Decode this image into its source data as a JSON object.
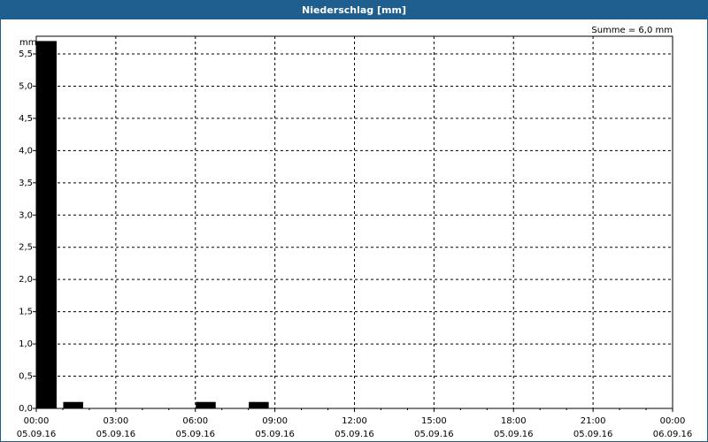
{
  "window": {
    "title": "Niederschlag [mm]"
  },
  "chart_data": {
    "type": "bar",
    "title": "Niederschlag [mm]",
    "ylabel": "mm",
    "xlabel": "",
    "summary": "Summe = 6,0 mm",
    "ylim": [
      0,
      5.5
    ],
    "yticks": [
      0.0,
      0.5,
      1.0,
      1.5,
      2.0,
      2.5,
      3.0,
      3.5,
      4.0,
      4.5,
      5.0,
      5.5
    ],
    "ytick_labels": [
      "0,0",
      "0,5",
      "1,0",
      "1,5",
      "2,0",
      "2,5",
      "3,0",
      "3,5",
      "4,0",
      "4,5",
      "5,0",
      "5,5"
    ],
    "x_range_hours": [
      0,
      24
    ],
    "xticks": [
      {
        "time": "00:00",
        "date": "05.09.16",
        "hour": 0
      },
      {
        "time": "03:00",
        "date": "05.09.16",
        "hour": 3
      },
      {
        "time": "06:00",
        "date": "05.09.16",
        "hour": 6
      },
      {
        "time": "09:00",
        "date": "05.09.16",
        "hour": 9
      },
      {
        "time": "12:00",
        "date": "05.09.16",
        "hour": 12
      },
      {
        "time": "15:00",
        "date": "05.09.16",
        "hour": 15
      },
      {
        "time": "18:00",
        "date": "05.09.16",
        "hour": 18
      },
      {
        "time": "21:00",
        "date": "05.09.16",
        "hour": 21
      },
      {
        "time": "00:00",
        "date": "06.09.16",
        "hour": 24
      }
    ],
    "series": [
      {
        "bars": [
          {
            "start_hour": 0,
            "end_hour": 0.75,
            "value": 5.7
          },
          {
            "start_hour": 1,
            "end_hour": 1.75,
            "value": 0.1
          },
          {
            "start_hour": 6,
            "end_hour": 6.75,
            "value": 0.1
          },
          {
            "start_hour": 8,
            "end_hour": 8.75,
            "value": 0.1
          }
        ]
      }
    ],
    "grid": true,
    "colors": {
      "bar": "#000000",
      "frame": "#1f5f8f",
      "grid": "#000000"
    }
  }
}
